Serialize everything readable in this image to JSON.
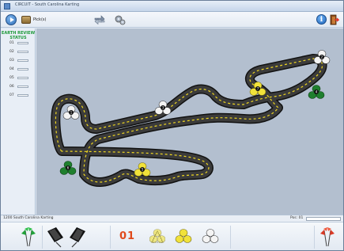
{
  "window": {
    "title": "CIRCUIT - South Carolina Karting"
  },
  "toolbar": {
    "pick_label": "Pick(s)"
  },
  "status_panel": {
    "header_line1": "EARTH REVIEW",
    "header_line2": "STATUS",
    "slots": [
      "01",
      "02",
      "03",
      "04",
      "05",
      "06",
      "07"
    ]
  },
  "track": {
    "markers": [
      {
        "number": "1",
        "color": "white"
      },
      {
        "number": "2",
        "color": "white"
      },
      {
        "number": "3",
        "color": "white"
      },
      {
        "number": "4",
        "color": "green"
      },
      {
        "number": "5",
        "color": "yellow"
      },
      {
        "number": "6",
        "color": "green"
      },
      {
        "number": "7",
        "color": "yellow"
      }
    ]
  },
  "statusbar": {
    "left_text": "1200 South Carolina Karting",
    "right_text": "Pos: 01"
  },
  "bottom": {
    "counter": "01"
  },
  "colors": {
    "accent": "#2f6fb8",
    "green": "#1e9a3a",
    "track_bg": "#b3bfcf",
    "counter_red": "#e04a1c"
  }
}
